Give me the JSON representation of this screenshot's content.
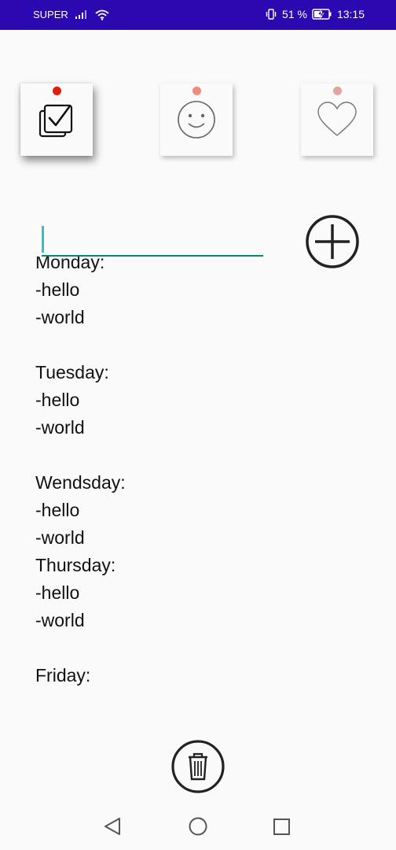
{
  "status_bar": {
    "carrier": "SUPER",
    "battery_percent": "51 %",
    "time": "13:15"
  },
  "tiles": [
    {
      "name": "tasks",
      "icon": "checklist-icon",
      "pin_color": "#e31b0c"
    },
    {
      "name": "mood",
      "icon": "smiley-icon",
      "pin_color": "#f28b7d"
    },
    {
      "name": "favorites",
      "icon": "heart-icon",
      "pin_color": "#e3a49b"
    }
  ],
  "input": {
    "value": "",
    "placeholder": ""
  },
  "notes": {
    "lines": [
      "Monday:",
      "-hello",
      "-world",
      "",
      "Tuesday:",
      "-hello",
      "-world",
      "",
      "Wendsday:",
      "-hello",
      "-world",
      "Thursday:",
      "-hello",
      "-world",
      "",
      "Friday:"
    ]
  },
  "actions": {
    "add_icon": "plus-circle-icon",
    "delete_icon": "trash-icon"
  },
  "nav": {
    "back_icon": "back-triangle-icon",
    "home_icon": "home-circle-icon",
    "recents_icon": "recents-square-icon"
  },
  "colors": {
    "status_bar": "#2b08b0",
    "input_underline": "#00897b",
    "caret": "#26c6c6",
    "background": "#fafafa"
  }
}
